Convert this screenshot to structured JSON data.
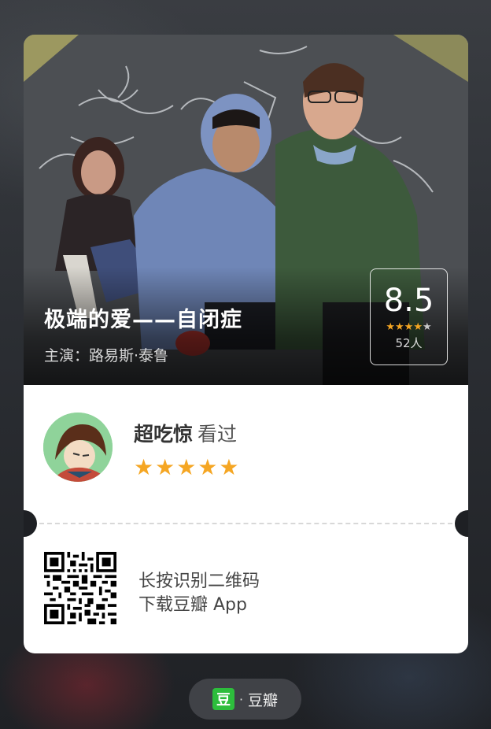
{
  "movie": {
    "title": "极端的爱——自闭症",
    "cast": "主演：路易斯·泰鲁",
    "rating": {
      "score": "8.5",
      "stars": "★★★★",
      "half_star": "★",
      "count": "52人"
    }
  },
  "review": {
    "user_name": "超吃惊",
    "action": "看过",
    "stars": "★★★★★",
    "star_value": 5
  },
  "qr": {
    "line1": "长按识别二维码",
    "line2": "下载豆瓣 App"
  },
  "brand": {
    "logo_char": "豆",
    "separator": "·",
    "name": "豆瓣"
  },
  "colors": {
    "star": "#f5a623",
    "brand_green": "#2dbd3c"
  }
}
